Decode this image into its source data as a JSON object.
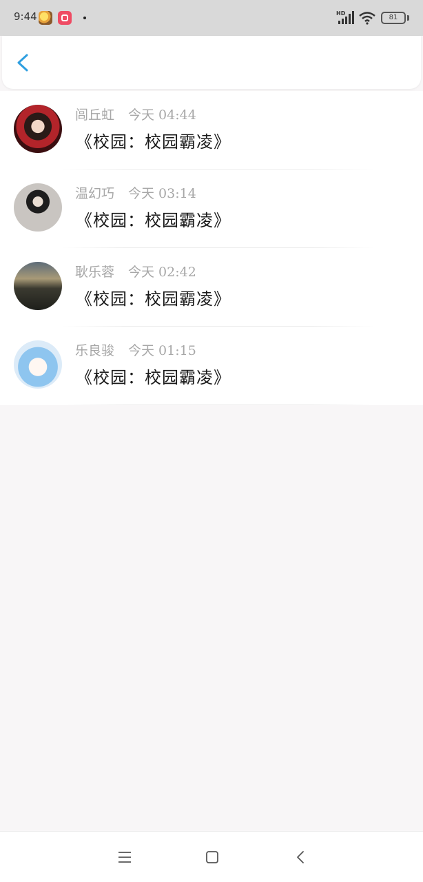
{
  "status_bar": {
    "time": "9:44",
    "battery": "81",
    "icons": [
      "app-notification-icon",
      "app-notification-icon",
      "dot-icon",
      "hd-signal-icon",
      "wifi-icon",
      "battery-icon"
    ]
  },
  "header": {
    "back_icon": "chevron-left-icon",
    "accent_color": "#2f9fe0"
  },
  "list": {
    "items": [
      {
        "name": "闾丘虹",
        "time": "今天 04:44",
        "title": "《校园：校园霸凌》"
      },
      {
        "name": "温幻巧",
        "time": "今天 03:14",
        "title": "《校园：校园霸凌》"
      },
      {
        "name": "耿乐蓉",
        "time": "今天 02:42",
        "title": "《校园：校园霸凌》"
      },
      {
        "name": "乐良骏",
        "time": "今天 01:15",
        "title": "《校园：校园霸凌》"
      }
    ]
  },
  "nav_bar": {
    "icons": [
      "menu-icon",
      "home-square-icon",
      "back-chevron-icon"
    ]
  }
}
